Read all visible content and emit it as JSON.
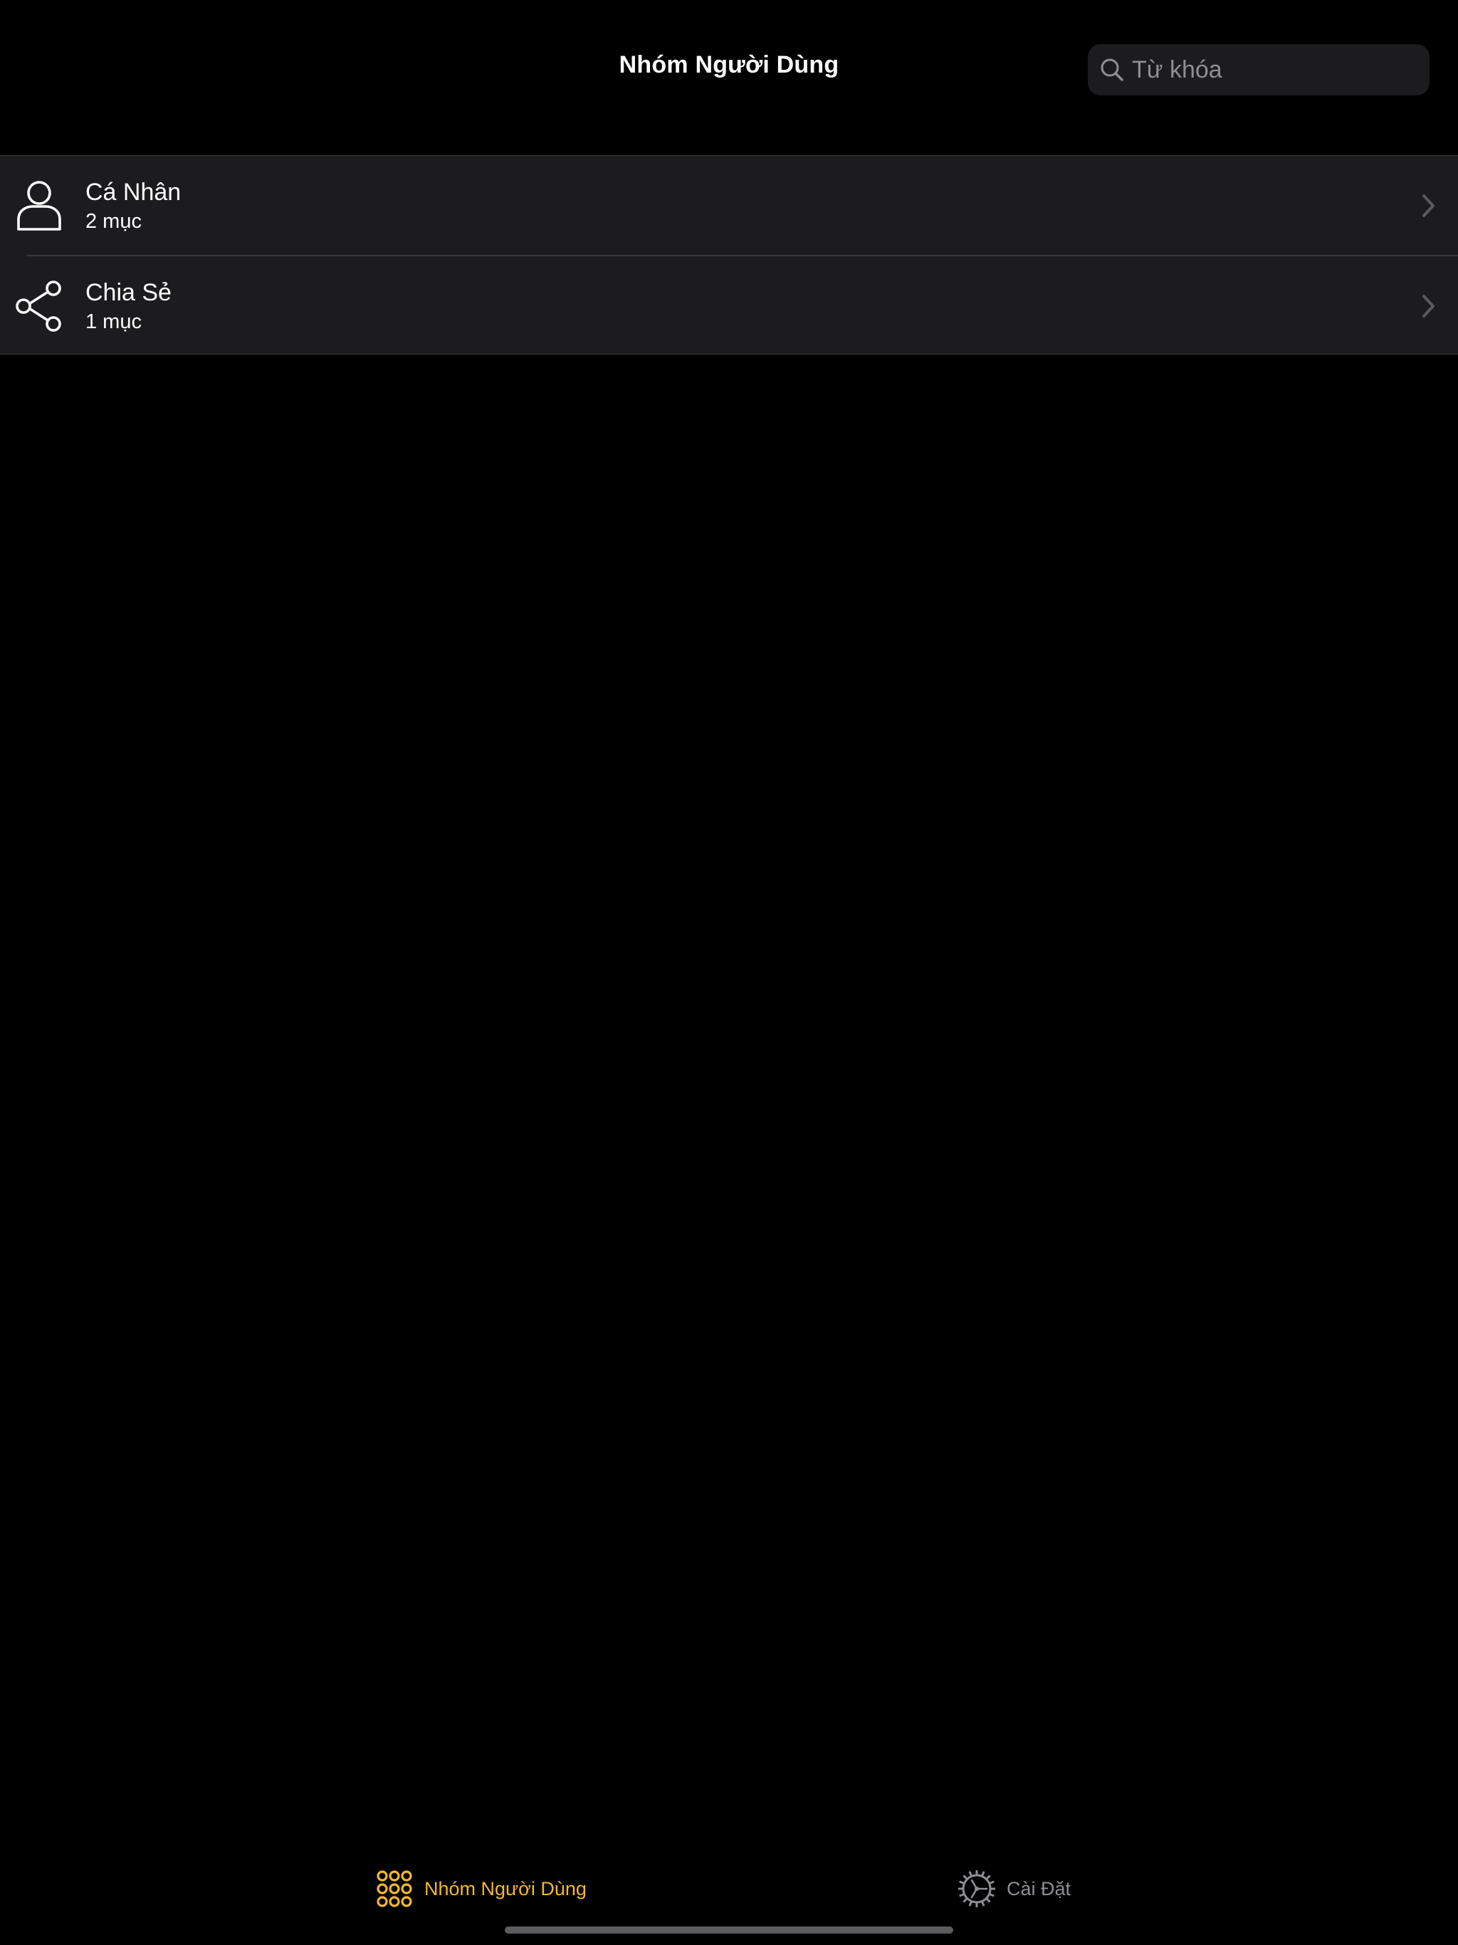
{
  "header": {
    "title": "Nhóm Người Dùng"
  },
  "search": {
    "placeholder": "Từ khóa",
    "value": ""
  },
  "groups": [
    {
      "title": "Cá Nhân",
      "subtitle": "2 mục",
      "icon": "person-icon"
    },
    {
      "title": "Chia Sẻ",
      "subtitle": "1 mục",
      "icon": "share-icon"
    }
  ],
  "tabs": [
    {
      "label": "Nhóm Người Dùng",
      "icon": "grid-dots-icon",
      "selected": true
    },
    {
      "label": "Cài Đặt",
      "icon": "gear-icon",
      "selected": false
    }
  ],
  "colors": {
    "background": "#000000",
    "cell_background": "#1c1c1e",
    "accent": "#f2b632",
    "inactive_tab": "#8e8e93",
    "separator": "#38383a"
  }
}
